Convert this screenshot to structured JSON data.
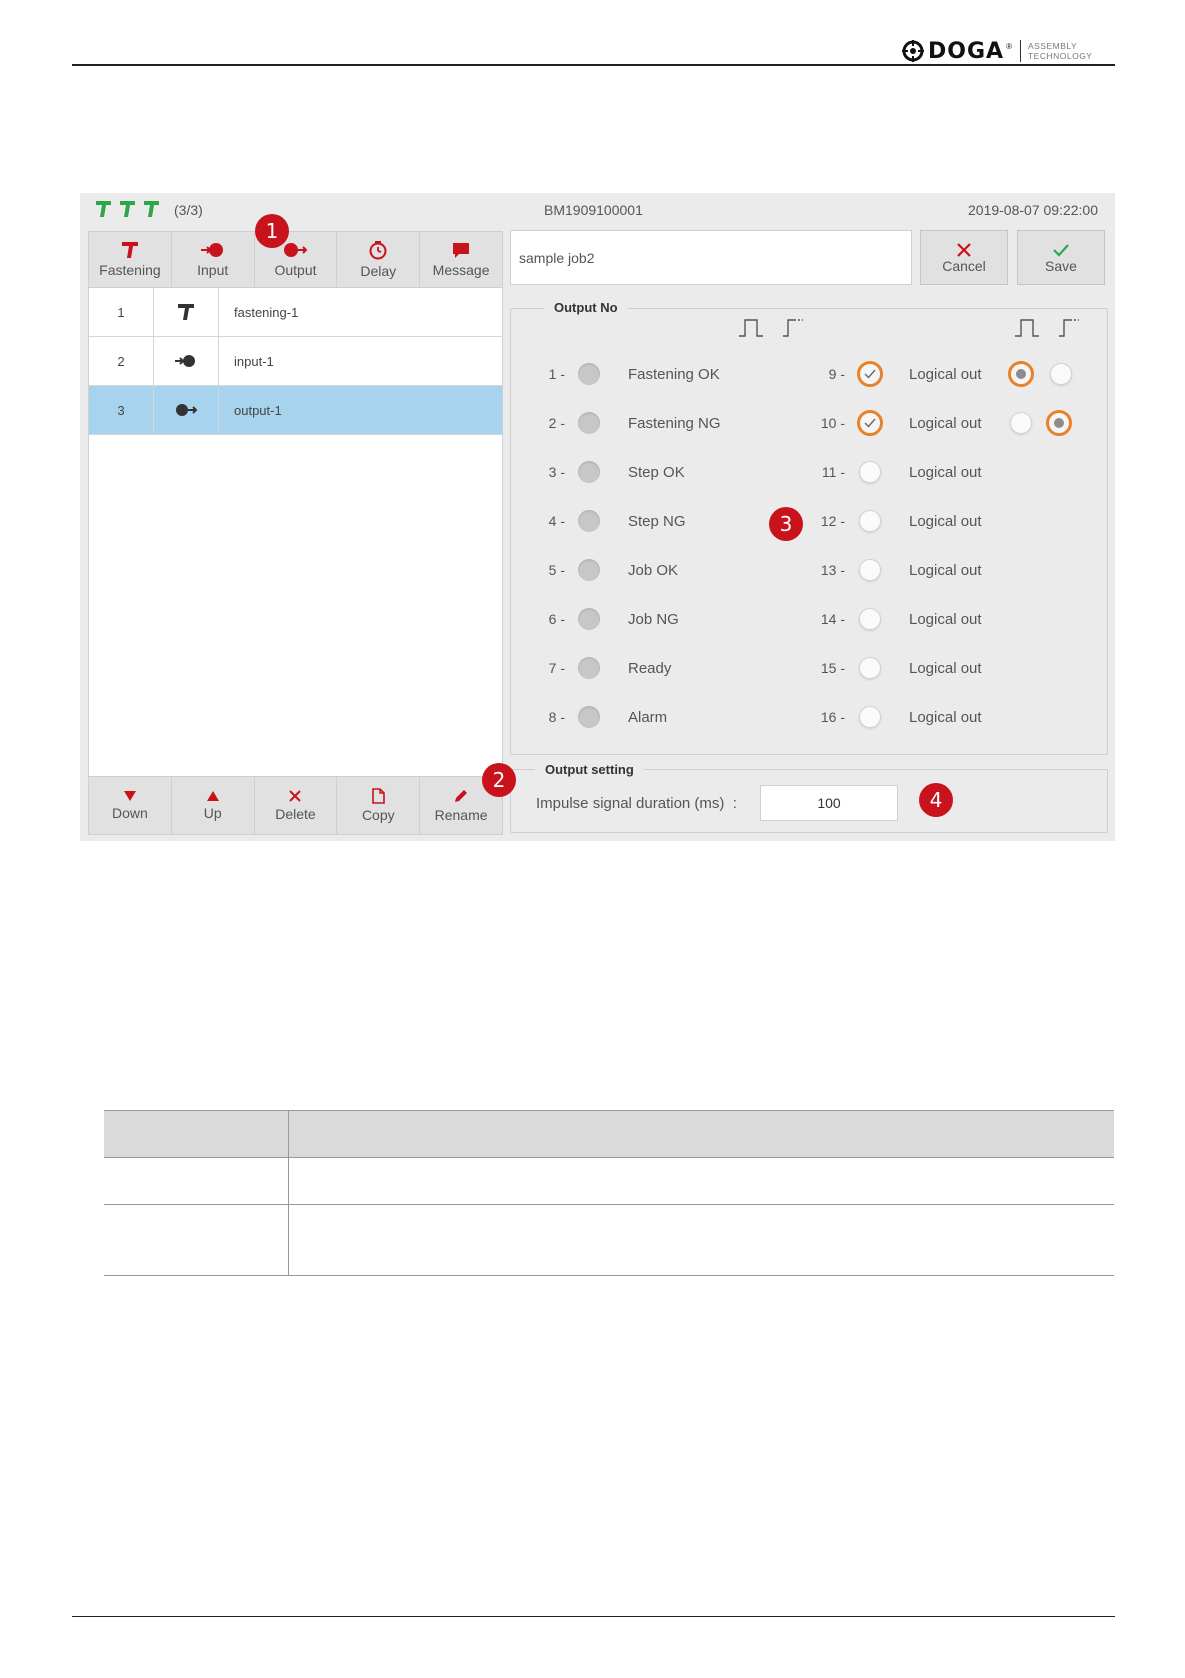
{
  "header": {
    "logo_text": "DOGA",
    "logo_reg": "®",
    "logo_tagline_1": "ASSEMBLY",
    "logo_tagline_2": "TECHNOLOGY"
  },
  "screenshot": {
    "status": {
      "tool_count": "(3/3)",
      "serial": "BM1909100001",
      "datetime": "2019-08-07 09:22:00"
    },
    "toolbar": [
      {
        "label": "Fastening",
        "icon": "fastening-tool-icon"
      },
      {
        "label": "Input",
        "icon": "input-icon"
      },
      {
        "label": "Output",
        "icon": "output-icon"
      },
      {
        "label": "Delay",
        "icon": "timer-icon"
      },
      {
        "label": "Message",
        "icon": "message-icon"
      }
    ],
    "steps": [
      {
        "no": "1",
        "icon": "fastening-tool-icon",
        "name": "fastening-1",
        "selected": false
      },
      {
        "no": "2",
        "icon": "input-icon",
        "name": "input-1",
        "selected": false
      },
      {
        "no": "3",
        "icon": "output-icon",
        "name": "output-1",
        "selected": true
      }
    ],
    "bottombar": [
      {
        "label": "Down",
        "icon": "arrow-down-icon"
      },
      {
        "label": "Up",
        "icon": "arrow-up-icon"
      },
      {
        "label": "Delete",
        "icon": "delete-x-icon"
      },
      {
        "label": "Copy",
        "icon": "copy-icon"
      },
      {
        "label": "Rename",
        "icon": "pencil-icon"
      }
    ],
    "job_name": "sample job2",
    "cancel_label": "Cancel",
    "save_label": "Save",
    "output_no": {
      "title": "Output No",
      "left": [
        {
          "no": "1 -",
          "label": "Fastening OK"
        },
        {
          "no": "2 -",
          "label": "Fastening NG"
        },
        {
          "no": "3 -",
          "label": "Step OK"
        },
        {
          "no": "4 -",
          "label": "Step NG"
        },
        {
          "no": "5 -",
          "label": "Job OK"
        },
        {
          "no": "6 -",
          "label": "Job NG"
        },
        {
          "no": "7 -",
          "label": "Ready"
        },
        {
          "no": "8 -",
          "label": "Alarm"
        }
      ],
      "right": [
        {
          "no": "9 -",
          "label": "Logical out",
          "checked": true,
          "signal": "pulse"
        },
        {
          "no": "10 -",
          "label": "Logical out",
          "checked": true,
          "signal": "level"
        },
        {
          "no": "11 -",
          "label": "Logical out",
          "checked": false
        },
        {
          "no": "12 -",
          "label": "Logical out",
          "checked": false
        },
        {
          "no": "13 -",
          "label": "Logical out",
          "checked": false
        },
        {
          "no": "14 -",
          "label": "Logical out",
          "checked": false
        },
        {
          "no": "15 -",
          "label": "Logical out",
          "checked": false
        },
        {
          "no": "16 -",
          "label": "Logical out",
          "checked": false
        }
      ]
    },
    "output_setting": {
      "title": "Output setting",
      "impulse_label": "Impulse signal duration (ms)  :",
      "impulse_value": "100"
    },
    "markers": [
      "1",
      "2",
      "3",
      "4"
    ]
  },
  "colors": {
    "accent_red": "#c8121c",
    "tool_green": "#2ca84a",
    "selected_row": "#a8d3ef",
    "checked_orange": "#e8822a"
  }
}
